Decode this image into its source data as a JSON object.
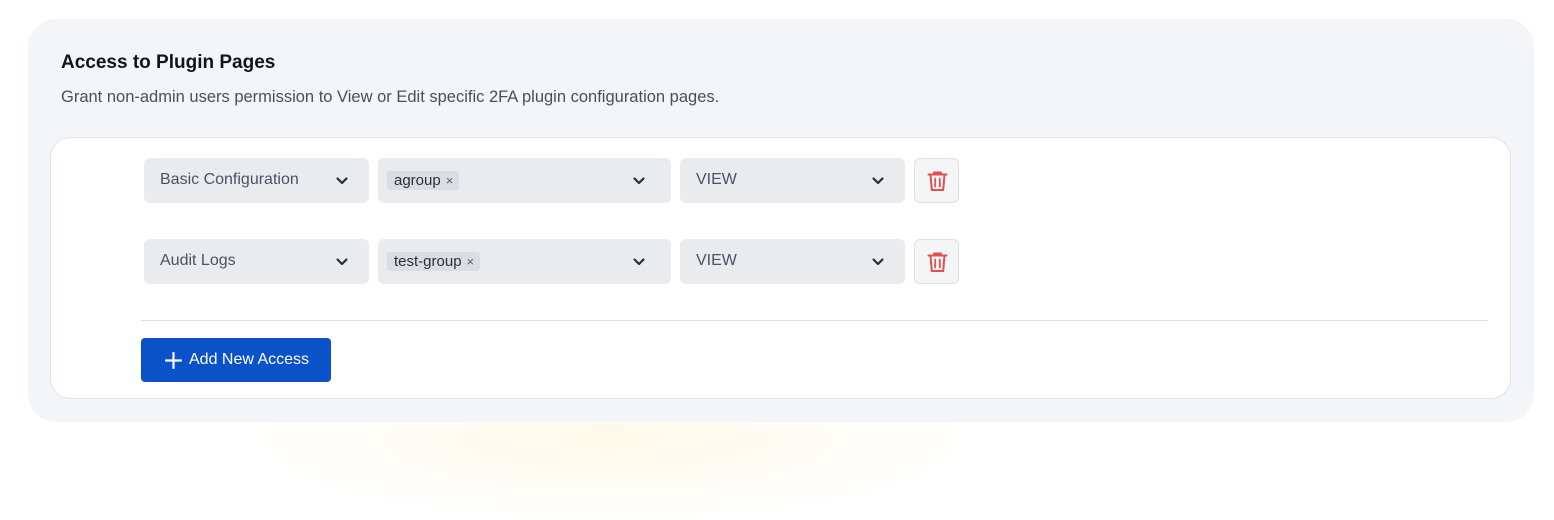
{
  "section": {
    "title": "Access to Plugin Pages",
    "description": "Grant non-admin users permission to View or Edit specific 2FA plugin configuration pages."
  },
  "rules": [
    {
      "page": "Basic Configuration",
      "groups": [
        "agroup"
      ],
      "permission": "VIEW"
    },
    {
      "page": "Audit Logs",
      "groups": [
        "test-group"
      ],
      "permission": "VIEW"
    }
  ],
  "tag_remove_glyph": "×",
  "add_button": {
    "label": "Add New Access",
    "icon": "plus-icon"
  },
  "icons": {
    "dropdown": "chevron-down-icon",
    "delete": "trash-icon"
  },
  "colors": {
    "primary": "#0a52c9",
    "danger": "#e0524f",
    "panel": "#f4f5f8"
  }
}
